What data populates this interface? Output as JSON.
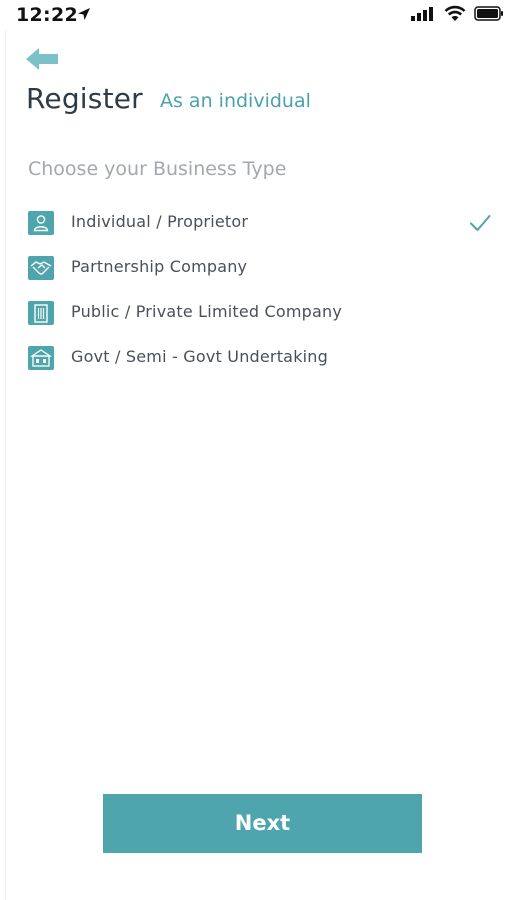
{
  "status_bar": {
    "time": "12:22",
    "icons": [
      "location-arrow-icon",
      "signal-icon",
      "wifi-icon",
      "battery-icon"
    ]
  },
  "header": {
    "back_icon": "back-arrow-icon",
    "title": "Register",
    "subtitle": "As an individual"
  },
  "business_type": {
    "heading": "Choose your Business Type",
    "options": [
      {
        "label": "Individual / Proprietor",
        "icon": "person-icon",
        "selected": true
      },
      {
        "label": "Partnership Company",
        "icon": "handshake-icon",
        "selected": false
      },
      {
        "label": "Public / Private Limited Company",
        "icon": "building-icon",
        "selected": false
      },
      {
        "label": "Govt / Semi - Govt Undertaking",
        "icon": "government-building-icon",
        "selected": false
      }
    ]
  },
  "footer": {
    "next_label": "Next"
  },
  "colors": {
    "accent": "#4EA5AD",
    "title": "#2F3A45",
    "muted": "#A3A8AD",
    "text": "#4A5059"
  }
}
